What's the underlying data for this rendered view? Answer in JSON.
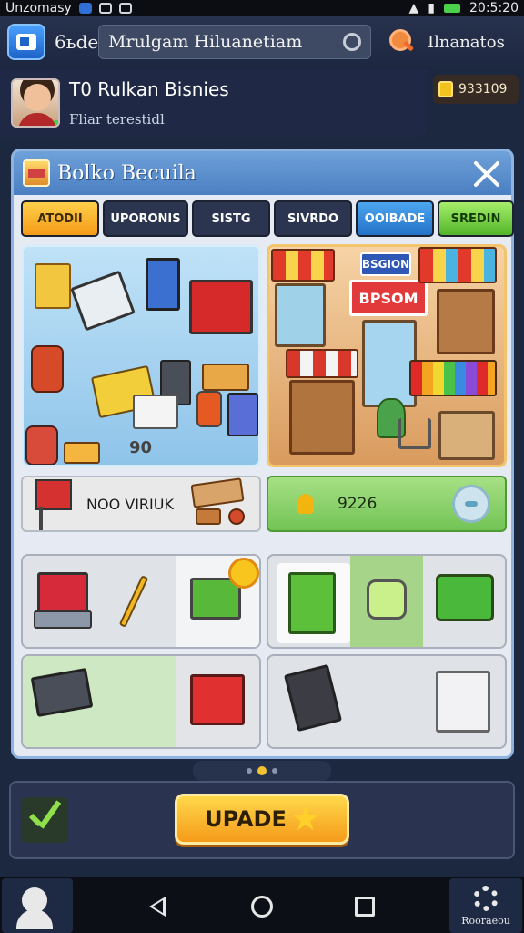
{
  "status_bar": {
    "left_text": "Unzomasy",
    "time": "20:5:20"
  },
  "header": {
    "left_label": "6ьde",
    "search_text": "Mrulgam Hiluanetiam",
    "right_label": "Ilnanatos"
  },
  "profile": {
    "name": "T0 Rulkan Bisnies",
    "subtitle": "Fliar terestidl",
    "coins": "933109"
  },
  "panel": {
    "title": "Bolko Becuila",
    "tabs": [
      {
        "label": "ATODII"
      },
      {
        "label": "UPORONIS"
      },
      {
        "label": "SISTG"
      },
      {
        "label": "SIVRDO"
      },
      {
        "label": "OOIBADE"
      },
      {
        "label": "SREDIN"
      }
    ],
    "art_left_badge": "90",
    "art_right_sign_top": "BSGION",
    "art_right_sign_main": "BPSOM",
    "sign_bar_text": "NOO VIRIUK",
    "green_bar_value": "9226"
  },
  "pagination": {
    "count": 3,
    "active": 1
  },
  "upgrade_button": {
    "label": "UPADE"
  },
  "nav": {
    "right_label": "Rooraeou"
  },
  "colors": {
    "accent_orange": "#f59b17",
    "accent_green": "#72c455",
    "accent_blue": "#2372c8",
    "panel_head": "#4a7fc2"
  }
}
